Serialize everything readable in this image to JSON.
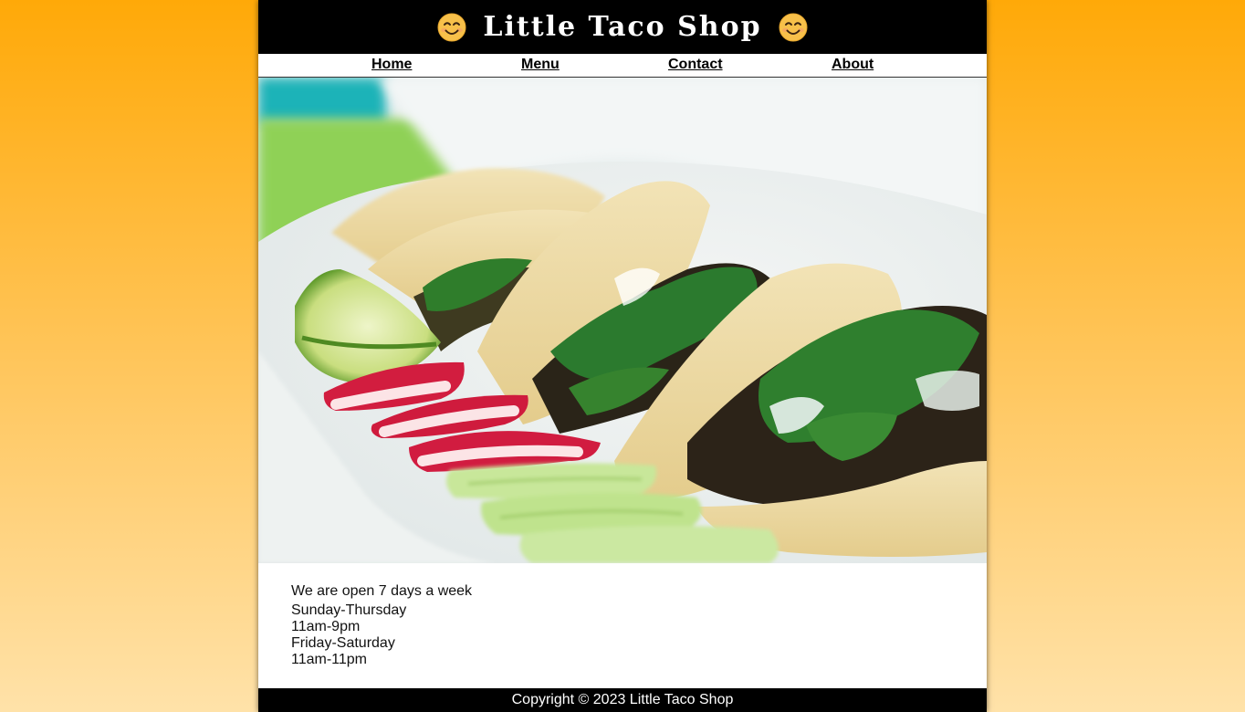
{
  "header": {
    "title": "Little Taco Shop",
    "emoji_icon": "smiling-face-icon"
  },
  "nav": {
    "items": [
      {
        "label": "Home"
      },
      {
        "label": "Menu"
      },
      {
        "label": "Contact"
      },
      {
        "label": "About"
      }
    ]
  },
  "hero": {
    "image_subject": "tacos-photo"
  },
  "hours": {
    "intro": "We are open 7 days a week",
    "lines": [
      "Sunday-Thursday",
      "11am-9pm",
      "Friday-Saturday",
      "11am-11pm"
    ]
  },
  "footer": {
    "copyright": "Copyright © 2023 Little Taco Shop"
  },
  "colors": {
    "background_top": "#ffa908",
    "background_bottom": "#ffe2a9",
    "header_bg": "#000000",
    "footer_bg": "#000000"
  }
}
